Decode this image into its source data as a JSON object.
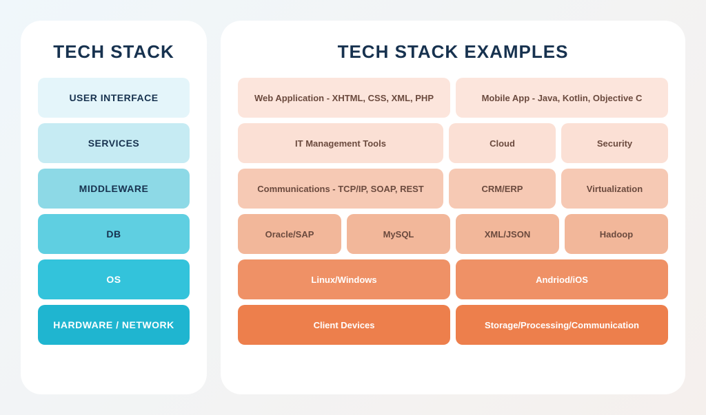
{
  "stack": {
    "title": "TECH STACK",
    "layers": [
      "USER INTERFACE",
      "SERVICES",
      "MIDDLEWARE",
      "DB",
      "OS",
      "HARDWARE / NETWORK"
    ]
  },
  "examples": {
    "title": "TECH STACK EXAMPLES",
    "rows": [
      [
        "Web Application - XHTML, CSS, XML, PHP",
        "Mobile App - Java, Kotlin, Objective C"
      ],
      [
        "IT Management Tools",
        "Cloud",
        "Security"
      ],
      [
        "Communications - TCP/IP, SOAP, REST",
        "CRM/ERP",
        "Virtualization"
      ],
      [
        "Oracle/SAP",
        "MySQL",
        "XML/JSON",
        "Hadoop"
      ],
      [
        "Linux/Windows",
        "Andriod/iOS"
      ],
      [
        "Client Devices",
        "Storage/Processing/Communication"
      ]
    ]
  }
}
